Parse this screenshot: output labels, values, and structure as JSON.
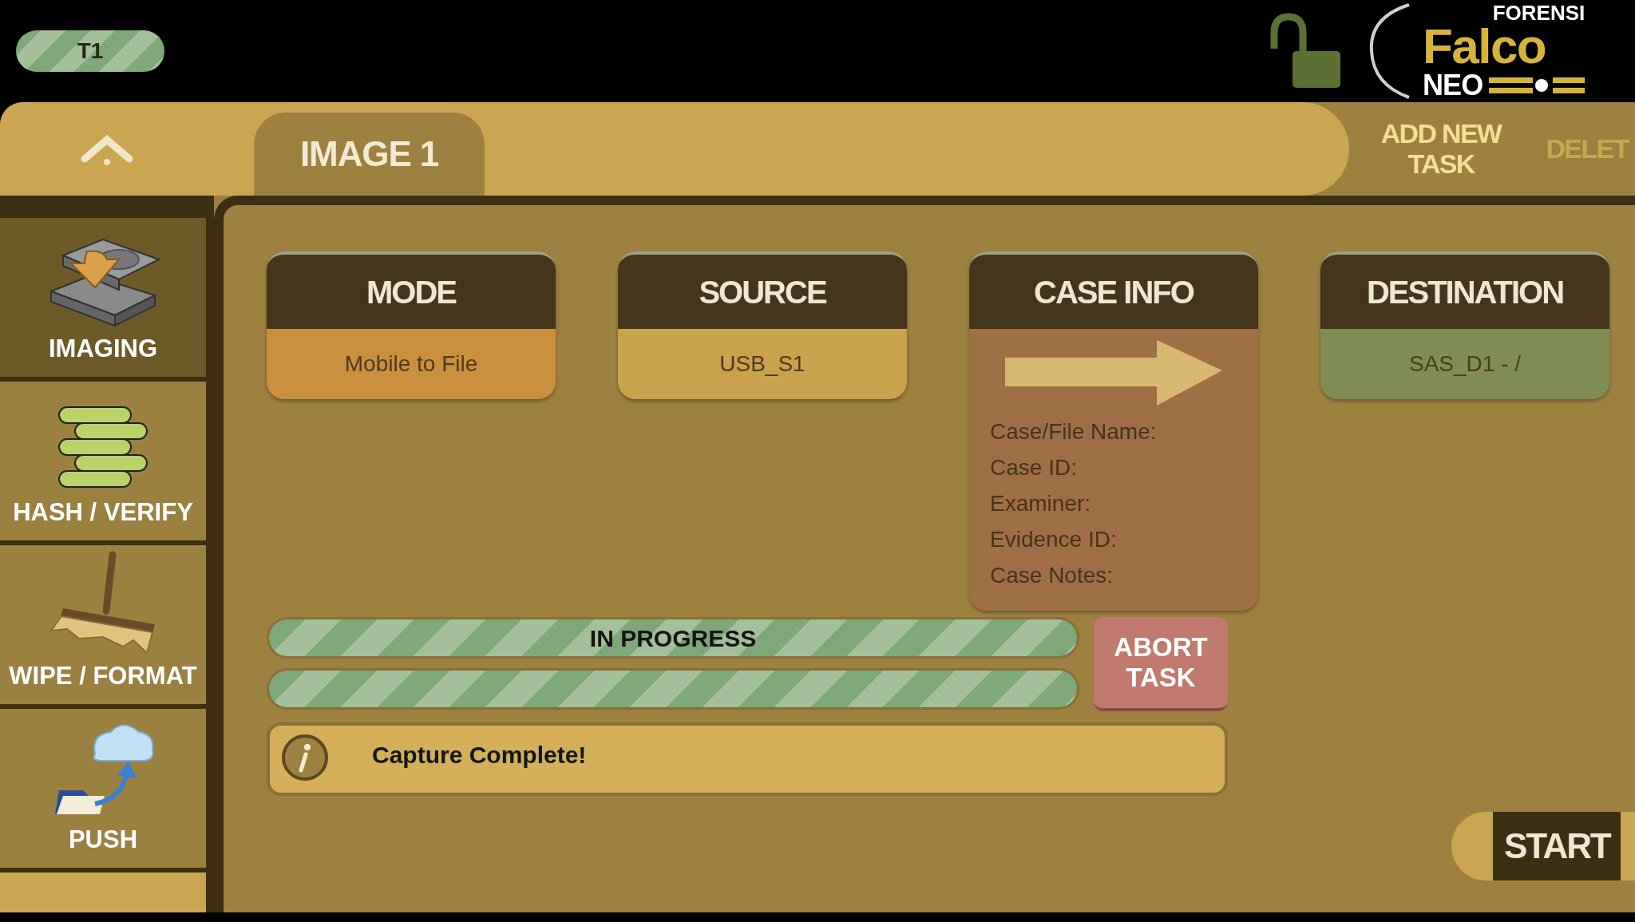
{
  "header": {
    "badge": "T1",
    "locked": false,
    "logo": {
      "top": "FORENSI",
      "main": "Falco",
      "sub": "NEO"
    }
  },
  "task_tabs": [
    {
      "label": "IMAGE 1",
      "selected": true
    }
  ],
  "actions": [
    {
      "label": "ADD NEW TASK",
      "disabled": false
    },
    {
      "label": "DELET",
      "disabled": true
    }
  ],
  "sidebar": {
    "items": [
      {
        "label": "IMAGING",
        "kind": "imaging",
        "selected": true
      },
      {
        "label": "HASH / VERIFY",
        "kind": "hash",
        "selected": false
      },
      {
        "label": "WIPE / FORMAT",
        "kind": "wipe",
        "selected": false
      },
      {
        "label": "PUSH",
        "kind": "push",
        "selected": false
      }
    ]
  },
  "cards": [
    {
      "title": "MODE",
      "kind": "value",
      "value": "Mobile to File",
      "color": "#c8903f"
    },
    {
      "title": "SOURCE",
      "kind": "value",
      "value": "USB_S1",
      "color": "#c9a24e"
    },
    {
      "title": "CASE INFO",
      "kind": "case",
      "color": "#9e6f45",
      "fields": [
        "Case/File Name:",
        "Case ID:",
        "Examiner:",
        "Evidence ID:",
        "Case Notes:"
      ]
    },
    {
      "title": "DESTINATION",
      "kind": "value",
      "value": "SAS_D1 - /",
      "color": "#7f8d55"
    }
  ],
  "progress": [
    {
      "label": "IN PROGRESS",
      "level": 1
    },
    {
      "level": 1
    }
  ],
  "abort_button": "ABORT TASK",
  "message": "Capture Complete!",
  "start_button": "START"
}
